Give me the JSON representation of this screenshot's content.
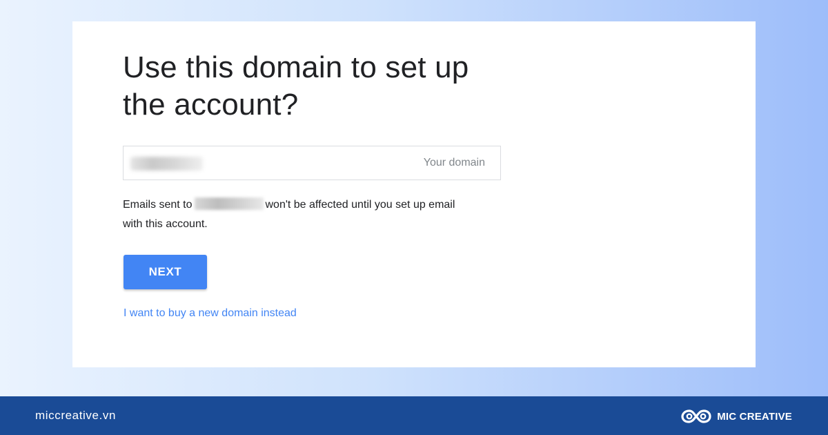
{
  "page": {
    "title_line1": "Use this domain to set up",
    "title_line2": "the account?"
  },
  "domain_input": {
    "value": "",
    "hint": "Your domain"
  },
  "notice": {
    "prefix": "Emails sent to",
    "suffix": "won't be affected until you set up email",
    "line2": "with this account."
  },
  "buttons": {
    "next_label": "NEXT"
  },
  "links": {
    "buy_domain": "I want to buy a new domain instead"
  },
  "footer": {
    "website": "miccreative.vn",
    "brand_name": "MIC CREATIVE",
    "brand_logo_icon": "infinity-logo-icon"
  },
  "colors": {
    "primary_blue": "#4285f4",
    "footer_bg": "#1a4b96",
    "text": "#202124",
    "hint": "#80868b"
  }
}
